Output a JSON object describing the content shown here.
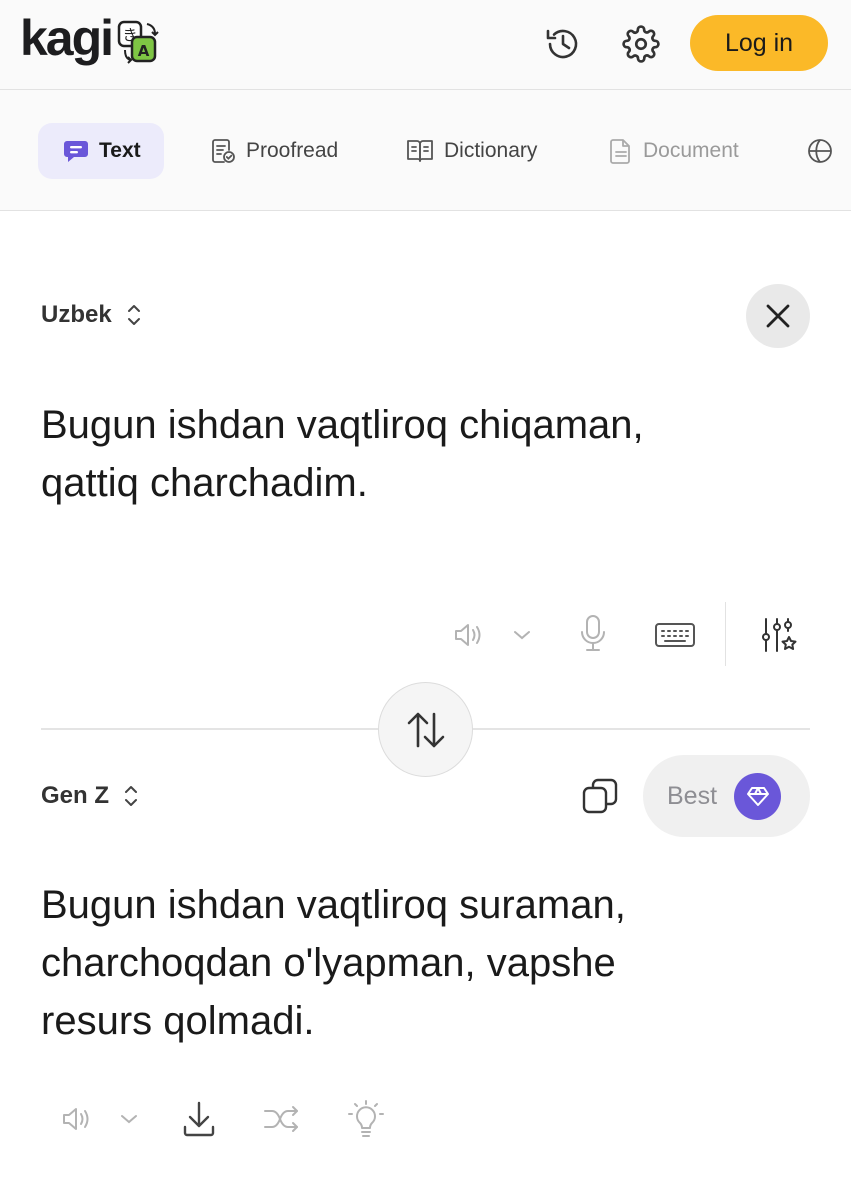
{
  "header": {
    "logo_text": "kagi",
    "badge_glyphs": [
      "き",
      "A"
    ],
    "login_label": "Log in",
    "icons": [
      "history-icon",
      "settings-gear-icon"
    ]
  },
  "tabs": [
    {
      "label": "Text",
      "icon": "chat-bubble-icon",
      "active": true
    },
    {
      "label": "Proofread",
      "icon": "proofread-doc-check-icon",
      "active": false
    },
    {
      "label": "Dictionary",
      "icon": "open-book-icon",
      "active": false
    },
    {
      "label": "Document",
      "icon": "document-icon",
      "active": false
    }
  ],
  "source": {
    "language": "Uzbek",
    "text": "Bugun ishdan vaqtliroq chiqaman,\nqattiq charchadim.",
    "tools": [
      "speaker-icon",
      "chevron-down-icon",
      "microphone-icon",
      "keyboard-icon",
      "sliders-star-icon"
    ]
  },
  "target": {
    "language": "Gen Z",
    "text": "Bugun ishdan vaqtliroq suraman,\ncharchoqdan o'lyapman, vapshe\nresurs qolmadi.",
    "quality_label": "Best",
    "tools": [
      "speaker-icon",
      "chevron-down-icon",
      "download-icon",
      "shuffle-icon",
      "lightbulb-icon"
    ]
  },
  "colors": {
    "accent_purple": "#6a57d9",
    "login_yellow": "#fbb928",
    "active_tab_bg": "#ecebfb"
  }
}
